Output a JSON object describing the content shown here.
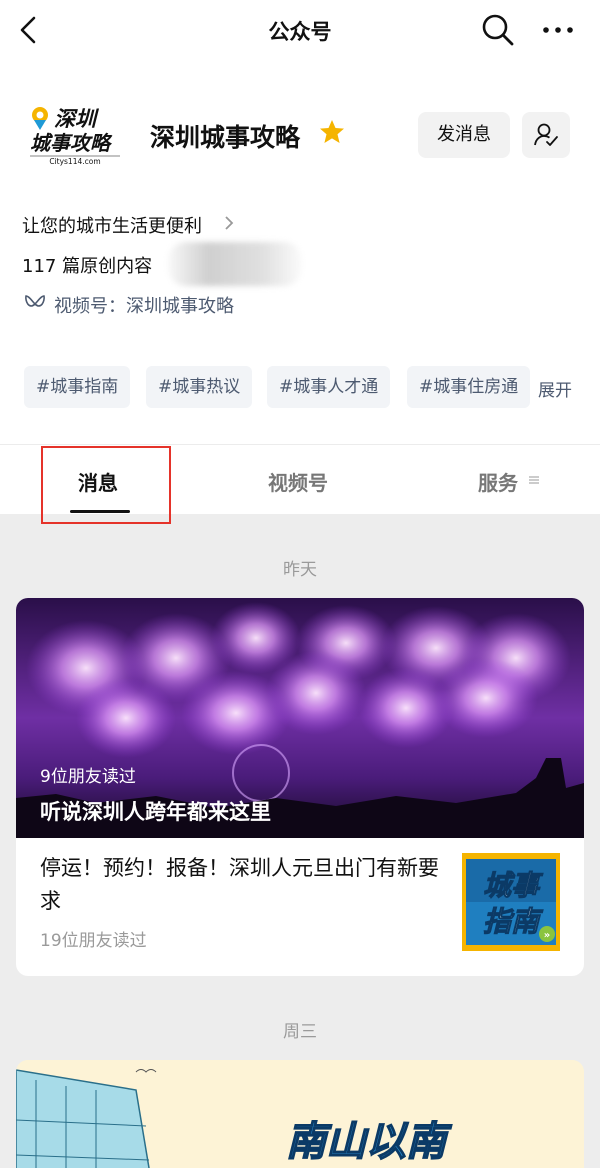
{
  "nav": {
    "title": "公众号",
    "icons": [
      "back-arrow-icon",
      "search-icon",
      "more-icon"
    ]
  },
  "account": {
    "logo_text_1": "深圳",
    "logo_text_2": "城事攻略",
    "logo_sub": "Citys114.com",
    "name": "深圳城事攻略",
    "send_message_label": "发消息",
    "description": "让您的城市生活更便利",
    "articles": "117 篇原创内容",
    "video_channel": "视频号：深圳城事攻略"
  },
  "tags": [
    "#城事指南",
    "#城事热议",
    "#城事人才通",
    "#城事住房通"
  ],
  "expand_label": "展开",
  "tabs": [
    {
      "label": "消息",
      "active": true
    },
    {
      "label": "视频号",
      "active": false
    },
    {
      "label": "服务",
      "active": false
    }
  ],
  "feed": {
    "date_1": "昨天",
    "main": {
      "readers": "9位朋友读过",
      "title": "听说深圳人跨年都来这里"
    },
    "sub": {
      "title": "停运！预约！报备！深圳人元旦出门有新要求",
      "readers": "19位朋友读过",
      "thumb_line_1": "城事",
      "thumb_line_2": "指南"
    },
    "date_2": "周三",
    "card2_text": "南山以南"
  },
  "colors": {
    "accent_blue": "#4d5a70",
    "highlight_red": "#e5332a",
    "star": "#f5b400",
    "page_bg": "#ededed"
  }
}
